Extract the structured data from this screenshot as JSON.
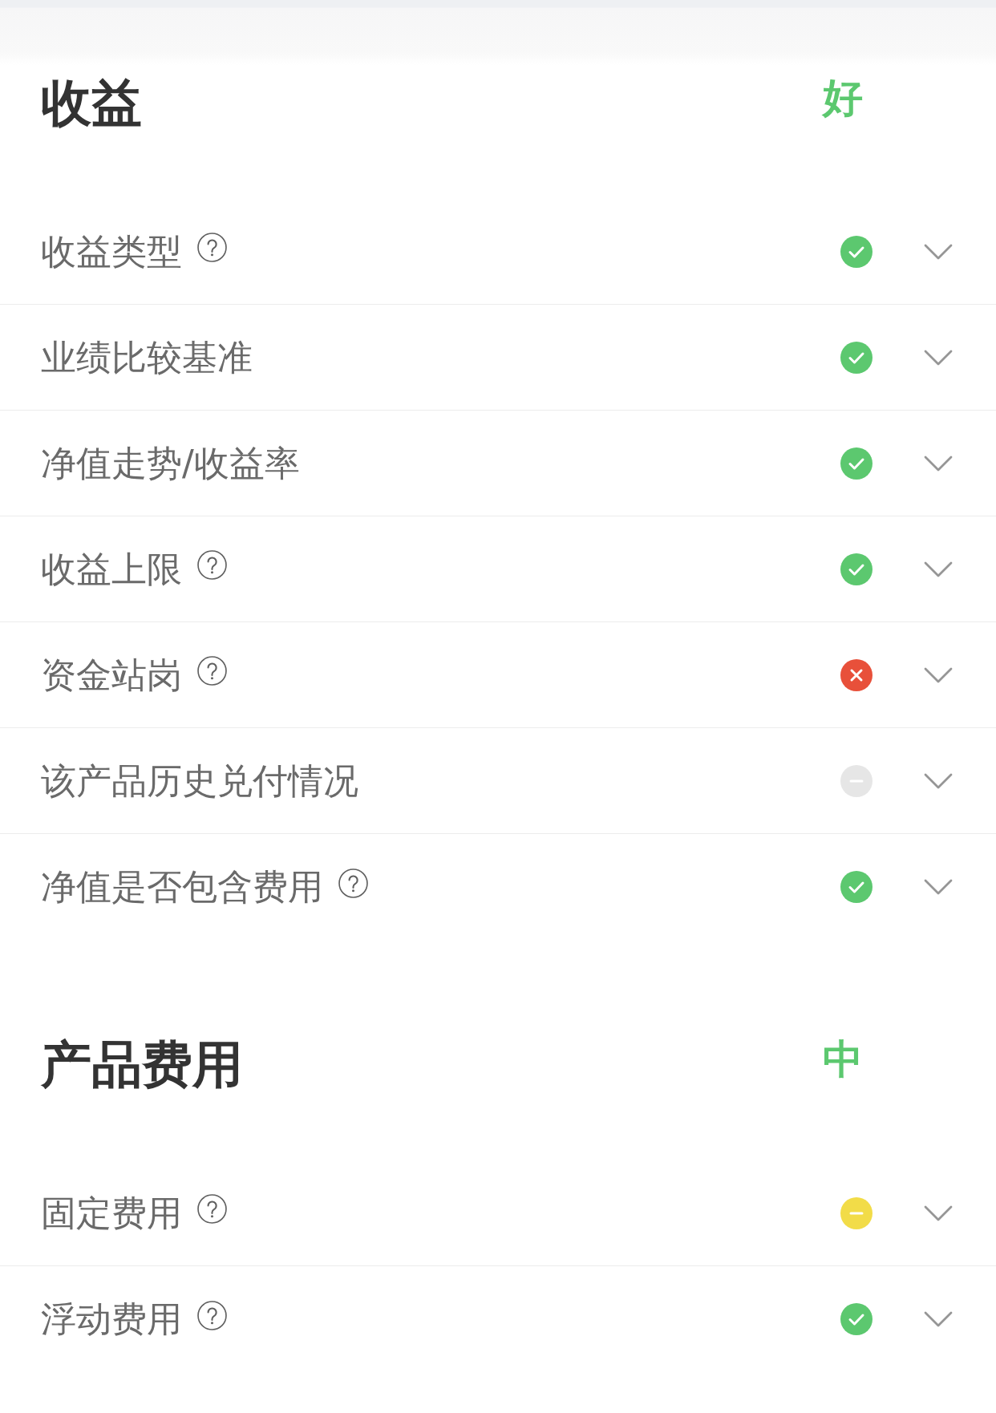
{
  "sections": [
    {
      "title": "收益",
      "rating": "好",
      "items": [
        {
          "label": "收益类型",
          "help": true,
          "kind": "pass",
          "expanded": false
        },
        {
          "label": "业绩比较基准",
          "help": false,
          "kind": "pass",
          "expanded": false
        },
        {
          "label": "净值走势/收益率",
          "help": false,
          "kind": "pass",
          "expanded": false
        },
        {
          "label": "收益上限",
          "help": true,
          "kind": "pass",
          "expanded": false
        },
        {
          "label": "资金站岗",
          "help": true,
          "kind": "fail",
          "expanded": false
        },
        {
          "label": "该产品历史兑付情况",
          "help": false,
          "kind": "none",
          "expanded": false
        },
        {
          "label": "净值是否包含费用",
          "help": true,
          "kind": "pass",
          "expanded": false
        }
      ]
    },
    {
      "title": "产品费用",
      "rating": "中",
      "items": [
        {
          "label": "固定费用",
          "help": true,
          "kind": "warn",
          "expanded": false
        },
        {
          "label": "浮动费用",
          "help": true,
          "kind": "pass",
          "expanded": false
        }
      ]
    }
  ]
}
